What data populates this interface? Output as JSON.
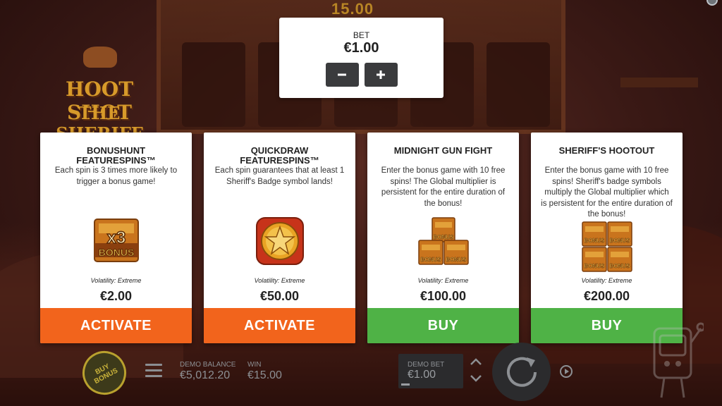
{
  "game": {
    "top_win_display": "15.00",
    "logo_line1": "HOOT SHOT",
    "logo_line2": "THE SHERIFF"
  },
  "bet_panel": {
    "label": "BET",
    "value": "€1.00",
    "decrease_icon": "minus-icon",
    "increase_icon": "plus-icon"
  },
  "cards": [
    {
      "title": "BONUSHUNT FEATURESPINS™",
      "description": "Each spin is 3 times more likely to trigger a bonus game!",
      "icon": "x3-bonus-badge",
      "icon_text_top": "x3",
      "icon_text_bottom": "BONUS",
      "volatility": "Volatility: Extreme",
      "price": "€2.00",
      "action": "ACTIVATE",
      "action_color": "#f2641c"
    },
    {
      "title": "QUICKDRAW FEATURESPINS™",
      "description": "Each spin guarantees that at least 1 Sheriff's Badge symbol lands!",
      "icon": "sheriff-badge-star",
      "volatility": "Volatility: Extreme",
      "price": "€50.00",
      "action": "ACTIVATE",
      "action_color": "#f2641c"
    },
    {
      "title": "MIDNIGHT GUN FIGHT",
      "description": "Enter the bonus game with 10 free spins! The Global multiplier is persistent for the entire duration of the bonus!",
      "icon": "triple-bonus-buildings",
      "icon_text": "BONUS",
      "volatility": "Volatility: Extreme",
      "price": "€100.00",
      "action": "BUY",
      "action_color": "#4fb246"
    },
    {
      "title": "SHERIFF'S HOOTOUT",
      "description": "Enter the bonus game with 10 free spins! Sheriff's badge symbols multiply the Global multiplier which is persistent for the entire duration of the bonus!",
      "icon": "quad-bonus-buildings",
      "icon_text": "BONUS",
      "volatility": "Volatility: Extreme",
      "price": "€200.00",
      "action": "BUY",
      "action_color": "#4fb246"
    }
  ],
  "bottom_bar": {
    "buy_bonus_label": "BUY BONUS",
    "menu_icon": "hamburger-menu-icon",
    "balance_label": "DEMO BALANCE",
    "balance_value": "€5,012.20",
    "win_label": "WIN",
    "win_value": "€15.00",
    "demo_bet_label": "DEMO BET",
    "demo_bet_value": "€1.00",
    "stepper_up_icon": "chevron-up-icon",
    "stepper_down_icon": "chevron-down-icon",
    "spin_icon": "spin-arrow-icon",
    "autoplay_icon": "autoplay-icon"
  }
}
